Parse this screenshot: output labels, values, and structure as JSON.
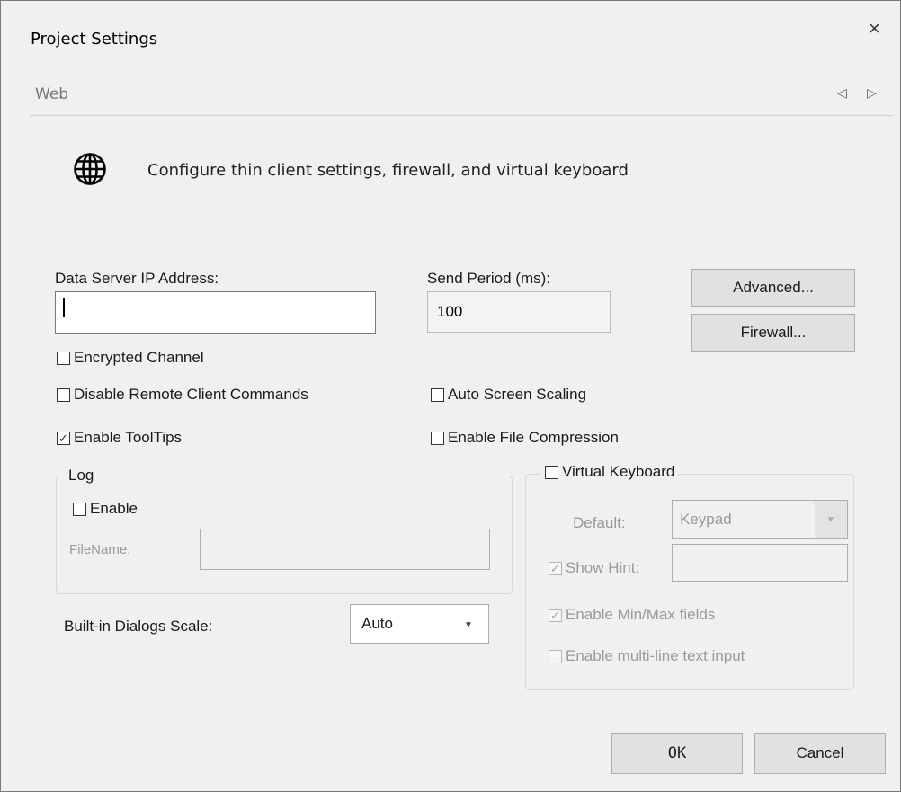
{
  "dialog": {
    "title": "Project Settings",
    "close_glyph": "×",
    "tab": "Web",
    "nav_prev_glyph": "◁",
    "nav_next_glyph": "▷",
    "description": "Configure thin client settings, firewall, and virtual keyboard",
    "header_icon": "globe-icon"
  },
  "fields": {
    "data_server_ip": {
      "label": "Data Server IP Address:",
      "value": ""
    },
    "send_period": {
      "label": "Send Period (ms):",
      "value": "100"
    }
  },
  "buttons": {
    "advanced": "Advanced...",
    "firewall": "Firewall...",
    "ok": "OK",
    "cancel": "Cancel"
  },
  "checkboxes": {
    "encrypted_channel": {
      "label": "Encrypted Channel",
      "checked": false
    },
    "disable_remote_commands": {
      "label": "Disable Remote Client Commands",
      "checked": false
    },
    "enable_tooltips": {
      "label": "Enable ToolTips",
      "checked": true
    },
    "auto_screen_scaling": {
      "label": "Auto Screen Scaling",
      "checked": false
    },
    "enable_file_compression": {
      "label": "Enable File Compression",
      "checked": false
    }
  },
  "log": {
    "legend": "Log",
    "enable_label": "Enable",
    "enable_checked": false,
    "filename_label": "FileName:",
    "filename_value": ""
  },
  "dialogs_scale": {
    "label": "Built-in Dialogs Scale:",
    "selected": "Auto"
  },
  "virtual_keyboard": {
    "legend": "Virtual Keyboard",
    "enabled": false,
    "default_label": "Default:",
    "default_value": "Keypad",
    "show_hint_label": "Show Hint:",
    "show_hint_checked": true,
    "show_hint_value": "",
    "min_max_label": "Enable Min/Max fields",
    "min_max_checked": true,
    "multiline_label": "Enable multi-line text input",
    "multiline_checked": false
  },
  "check_glyph": "✓",
  "dropdown_glyph": "▼"
}
